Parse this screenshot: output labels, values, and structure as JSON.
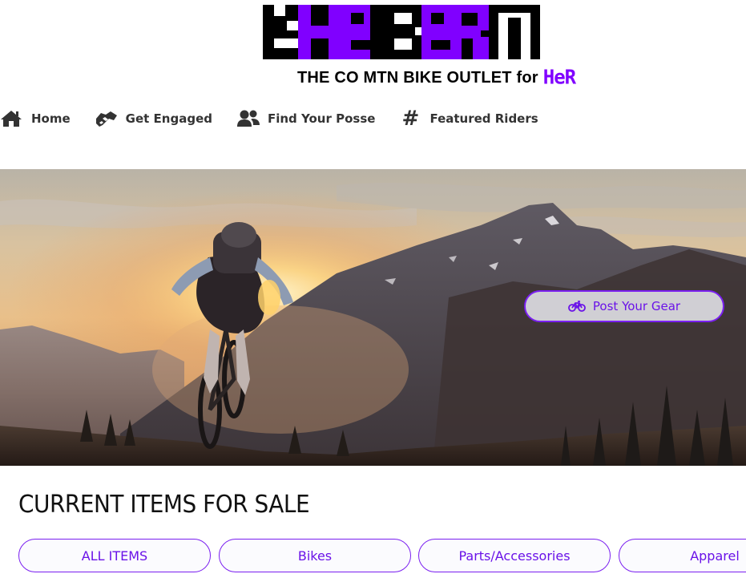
{
  "logo": {
    "wordmark": "tHe BeRM",
    "tagline": "THE CO MTN BIKE OUTLET for",
    "tagline_accent": "HeR",
    "brand_color": "#8000ff",
    "dark_color": "#000000"
  },
  "nav": {
    "items": [
      {
        "label": "Home",
        "icon": "home-icon"
      },
      {
        "label": "Get Engaged",
        "icon": "handshake-icon"
      },
      {
        "label": "Find Your Posse",
        "icon": "users-icon"
      },
      {
        "label": "Featured Riders",
        "icon": "hashtag-icon"
      }
    ]
  },
  "hero": {
    "image": "mountain biker jumping at sunset",
    "post_button": {
      "label": "Post Your Gear",
      "icon": "bicycle-icon"
    }
  },
  "items_section": {
    "title": "CURRENT ITEMS FOR SALE",
    "filters": [
      "ALL ITEMS",
      "Bikes",
      "Parts/Accessories",
      "Apparel"
    ]
  },
  "colors": {
    "accent": "#7a1ff0",
    "accent_text": "#6a12e8",
    "nav_text": "#333333"
  }
}
